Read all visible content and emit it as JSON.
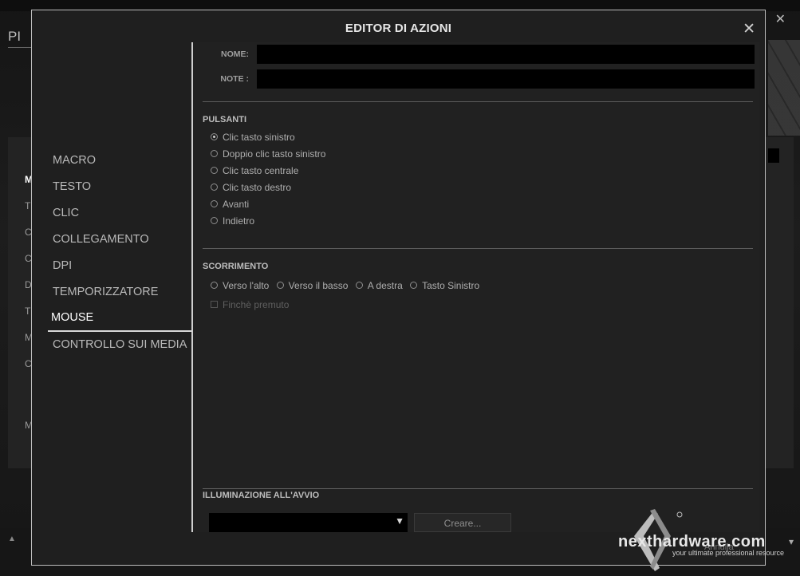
{
  "background": {
    "title_partial": "PI",
    "close_glyph": "✕",
    "side_letters": [
      "M",
      "T",
      "C",
      "C",
      "D",
      "T",
      "M",
      "C",
      "M"
    ],
    "scroll_up": "▲",
    "scroll_down": "▾"
  },
  "modal": {
    "title": "EDITOR DI AZIONI",
    "close_glyph": "✕"
  },
  "nav": {
    "items": [
      {
        "label": "MACRO"
      },
      {
        "label": "TESTO"
      },
      {
        "label": "CLIC"
      },
      {
        "label": "COLLEGAMENTO"
      },
      {
        "label": "DPI"
      },
      {
        "label": "TEMPORIZZATORE"
      },
      {
        "label": "MOUSE",
        "active": true
      },
      {
        "label": "CONTROLLO SUI MEDIA"
      }
    ]
  },
  "form": {
    "name_label": "NOME:",
    "name_value": "",
    "note_label": "NOTE :",
    "note_value": ""
  },
  "buttons_section": {
    "title": "PULSANTI",
    "options": [
      {
        "label": "Clic tasto sinistro",
        "selected": true
      },
      {
        "label": "Doppio clic tasto sinistro",
        "selected": false
      },
      {
        "label": "Clic tasto centrale",
        "selected": false
      },
      {
        "label": "Clic tasto destro",
        "selected": false
      },
      {
        "label": "Avanti",
        "selected": false
      },
      {
        "label": "Indietro",
        "selected": false
      }
    ]
  },
  "scroll_section": {
    "title": "SCORRIMENTO",
    "options": [
      {
        "label": "Verso l'alto"
      },
      {
        "label": "Verso il basso"
      },
      {
        "label": "A destra"
      },
      {
        "label": "Tasto Sinistro"
      }
    ],
    "hold_label": "Finchè premuto"
  },
  "lighting_section": {
    "title": "ILLUMINAZIONE ALL'AVVIO",
    "select_value": "",
    "select_arrow": "▼",
    "create_label": "Creare..."
  },
  "watermark": {
    "brand": "nexthardware.com",
    "tagline": "your ultimate professional resource",
    "annulla": "Annulla"
  },
  "colors": {
    "modal_bg": "#1f1f1f",
    "border": "#bdbdbd",
    "input_bg": "#000000"
  }
}
